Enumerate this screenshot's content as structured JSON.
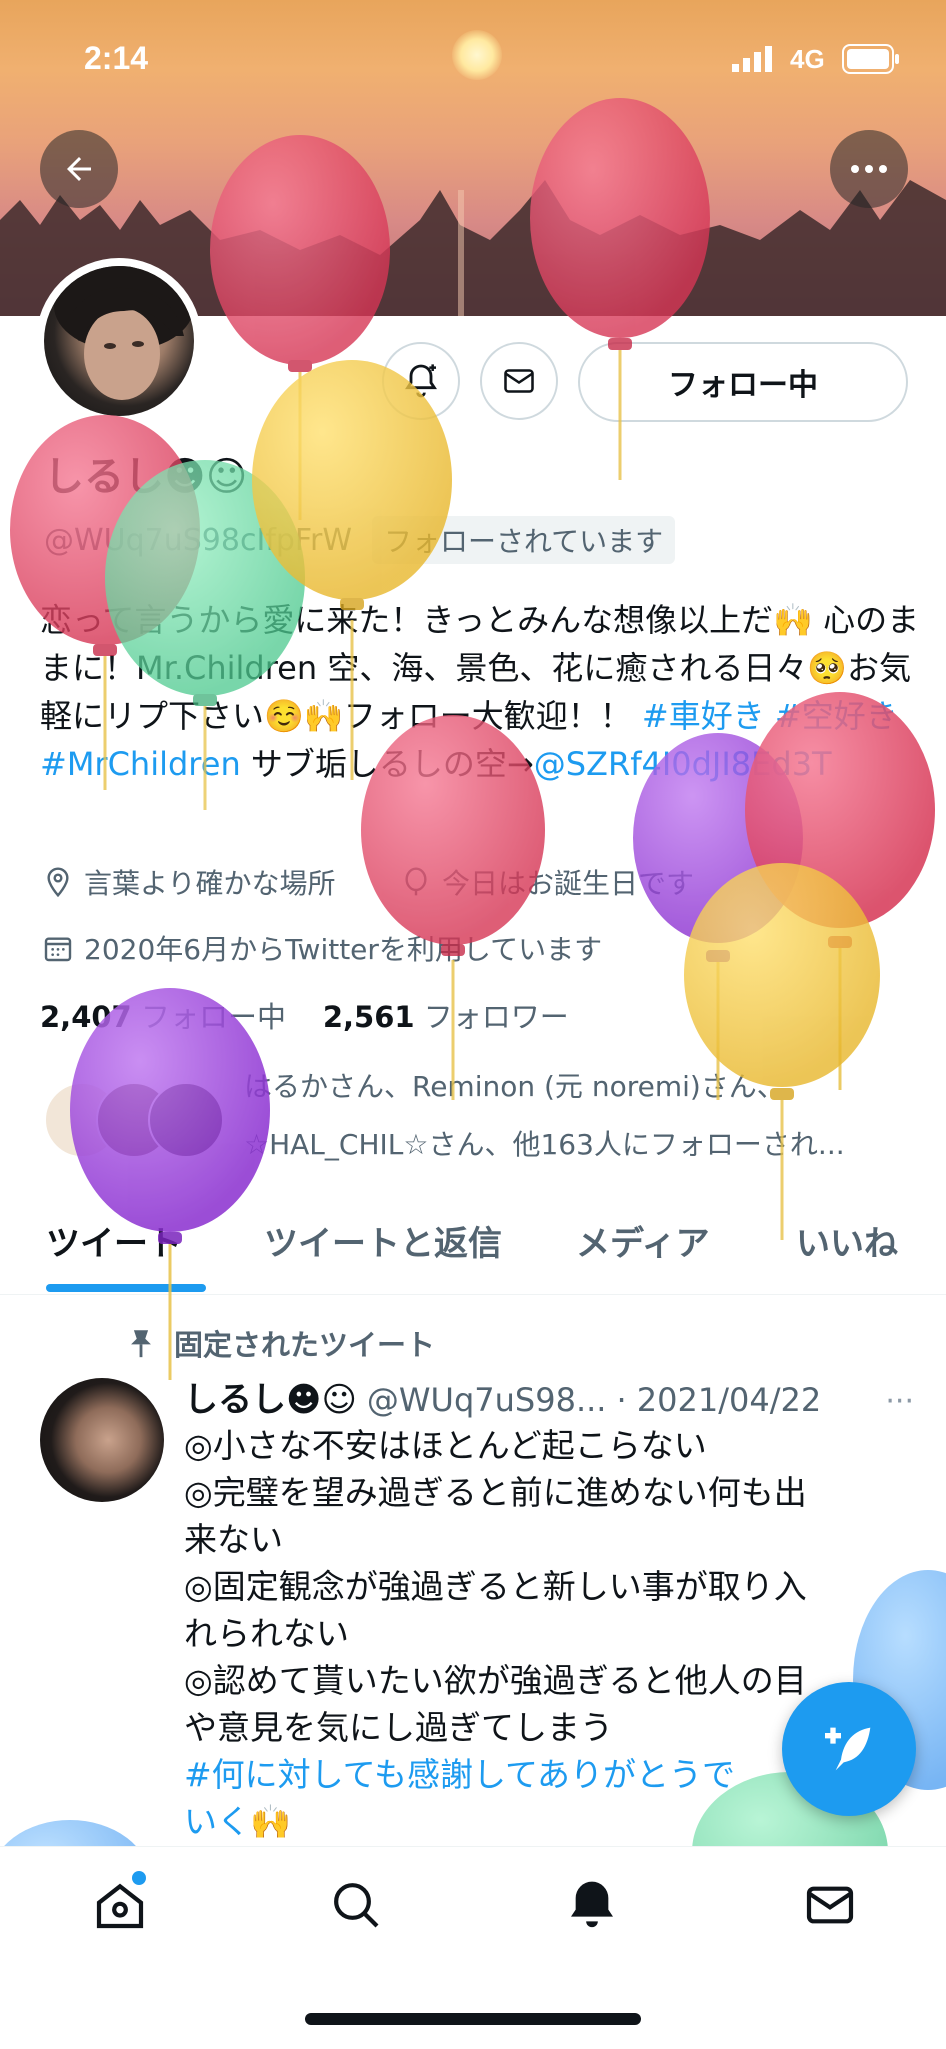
{
  "status_bar": {
    "time": "2:14",
    "network": "4G"
  },
  "profile": {
    "follow_button": "フォロー中",
    "display_name": "しるし☻☺",
    "handle": "@WUq7uS98cIfpFrW",
    "follows_you_badge": "フォローされています",
    "bio": {
      "text": "恋って言うから愛に来た！きっとみんな想像以上だ🙌 心のままに！Mr.Children 空、海、景色、花に癒される日々🥺お気軽にリプ下さい☺️🙌フォロー大歓迎！！",
      "hashtags": [
        "#車好き",
        "#空好き",
        "#MrChildren"
      ],
      "suffix": "サブ垢しるしの空→",
      "mention": "@SZRf4I0dJI8Ed3T"
    },
    "location": "言葉より確かな場所",
    "birthday": "今日はお誕生日です",
    "joined": "2020年6月からTwitterを利用しています",
    "following_count": "2,407",
    "following_label": "フォロー中",
    "followers_count": "2,561",
    "followers_label": "フォロワー",
    "followed_by_line1": "はるかさん、Reminon (元 noremi)さん、",
    "followed_by_line2": "☆HAL_CHIL☆さん、他163人にフォローされ..."
  },
  "tabs": [
    {
      "label": "ツイート",
      "active": true
    },
    {
      "label": "ツイートと返信",
      "active": false
    },
    {
      "label": "メディア",
      "active": false
    },
    {
      "label": "いいね",
      "active": false
    }
  ],
  "pinned_tweet": {
    "pinned_label": "固定されたツイート",
    "author_name": "しるし☻☺",
    "author_handle": "@WUq7uS98...",
    "date": "· 2021/04/22",
    "lines": [
      "◎小さな不安はほとんど起こらない",
      "◎完璧を望み過ぎると前に進めない何も出",
      "来ない",
      "◎固定観念が強過ぎると新しい事が取り入",
      "れられない",
      "◎認めて貰いたい欲が強過ぎると他人の目",
      "や意見を気にし過ぎてしまう"
    ],
    "hashtag_line1": "#何に対しても感謝してありがとうで",
    "hashtag_line2": "いく🙌"
  },
  "bottom_nav": [
    "home-icon",
    "search-icon",
    "notifications-icon",
    "messages-icon"
  ],
  "colors": {
    "accent": "#1d9bf0",
    "text": "#0f1419",
    "secondary": "#536471"
  }
}
